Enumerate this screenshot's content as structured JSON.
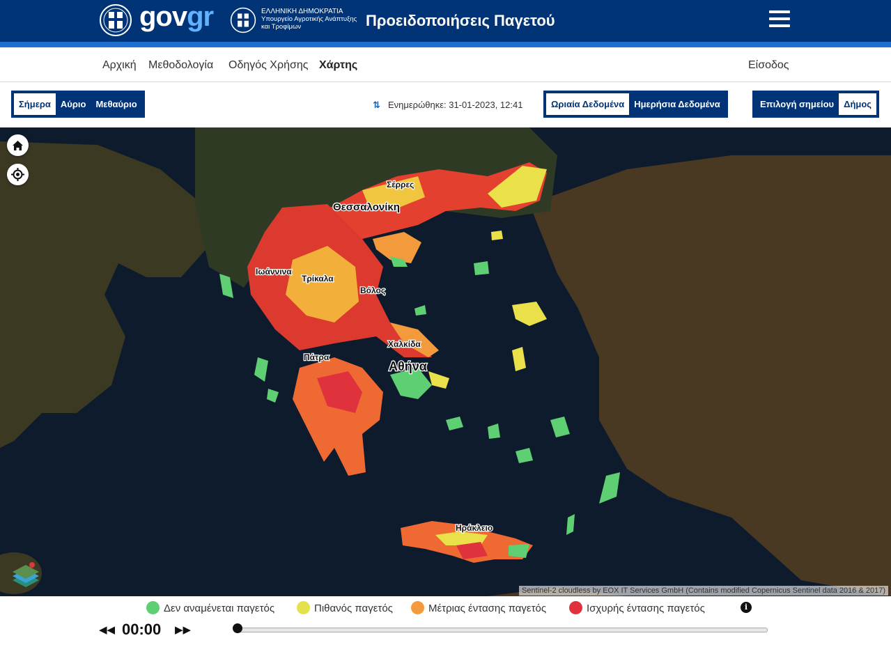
{
  "header": {
    "logo_text_gov": "gov",
    "logo_text_gr": "gr",
    "ministry_line1": "ΕΛΛΗΝΙΚΗ ΔΗΜΟΚΡΑΤΙΑ",
    "ministry_line2": "Υπουργείο Αγροτικής Ανάπτυξης",
    "ministry_line3": "και Τροφίμων",
    "site_title": "Προειδοποιήσεις Παγετού",
    "menu_icon": "hamburger-menu-icon",
    "colors": {
      "brand": "#003476",
      "stripe": "#1f6fd1",
      "accent": "#61b3ff"
    }
  },
  "nav": {
    "items": [
      {
        "label": "Αρχική"
      },
      {
        "label": "Μεθοδολογία"
      },
      {
        "label": "Οδηγός Χρήσης"
      },
      {
        "label": "Χάρτης",
        "active": true
      }
    ],
    "login_label": "Είσοδος"
  },
  "controls": {
    "day_options": [
      {
        "label": "Σήμερα",
        "selected": true
      },
      {
        "label": "Αύριο",
        "selected": false
      },
      {
        "label": "Μεθαύριο",
        "selected": false
      }
    ],
    "updated_text": "Ενημερώθηκε: 31-01-2023, 12:41",
    "data_options": [
      {
        "label": "Ωριαία Δεδομένα",
        "selected": true
      },
      {
        "label": "Ημερήσια Δεδομένα",
        "selected": false
      }
    ],
    "point_options": [
      {
        "label": "Επιλογή σημείου",
        "selected": false
      },
      {
        "label": "Δήμος",
        "selected": true
      }
    ]
  },
  "map": {
    "home_icon": "home-icon",
    "locate_icon": "locate-icon",
    "layers_icon": "layers-icon",
    "cities": [
      "Σέρρες",
      "Θεσσαλονίκη",
      "Ιωάννινα",
      "Τρίκαλα",
      "Βόλος",
      "Χαλκίδα",
      "Πάτρα",
      "Αθήνα",
      "Ηράκλειο"
    ],
    "attribution": "Sentinel-2 cloudless by EOX IT Services GmbH (Contains modified Copernicus Sentinel data 2016 & 2017)"
  },
  "legend": {
    "items": [
      {
        "label": "Δεν αναμένεται παγετός",
        "color": "#5fcf74"
      },
      {
        "label": "Πιθανός παγετός",
        "color": "#e4e24c"
      },
      {
        "label": "Μέτριας έντασης παγετός",
        "color": "#f39a3c"
      },
      {
        "label": "Ισχυρής έντασης παγετός",
        "color": "#e0323c"
      }
    ],
    "info_icon": "info-icon"
  },
  "player": {
    "rewind_icon": "rewind-icon",
    "forward_icon": "fast-forward-icon",
    "time": "00:00",
    "progress": 0
  }
}
